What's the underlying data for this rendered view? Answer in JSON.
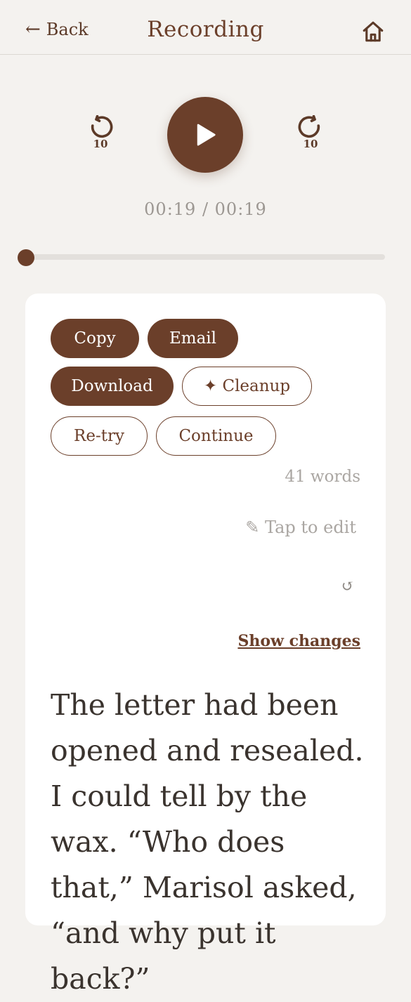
{
  "header": {
    "back_label": "Back",
    "back_arrow": "←",
    "title": "Recording",
    "home_icon": "home-icon"
  },
  "player": {
    "skip_back_seconds": "10",
    "skip_forward_seconds": "10",
    "time_display": "00:19 / 00:19",
    "progress_fraction": 0.0,
    "accent_color": "#6b3f2a"
  },
  "actions": {
    "copy_label": "Copy",
    "email_label": "Email",
    "download_label": "Download",
    "cleanup_label": "✦ Cleanup",
    "retry_label": "Re-try",
    "continue_label": "Continue"
  },
  "transcript": {
    "word_count": "41 words",
    "edit_hint": "✎ Tap to edit",
    "revert_icon": "↺",
    "show_changes_label": "Show changes",
    "text": "The letter had been opened and resealed. I could tell by the wax. “Who does that,” Marisol asked, “and why put it back?”"
  }
}
